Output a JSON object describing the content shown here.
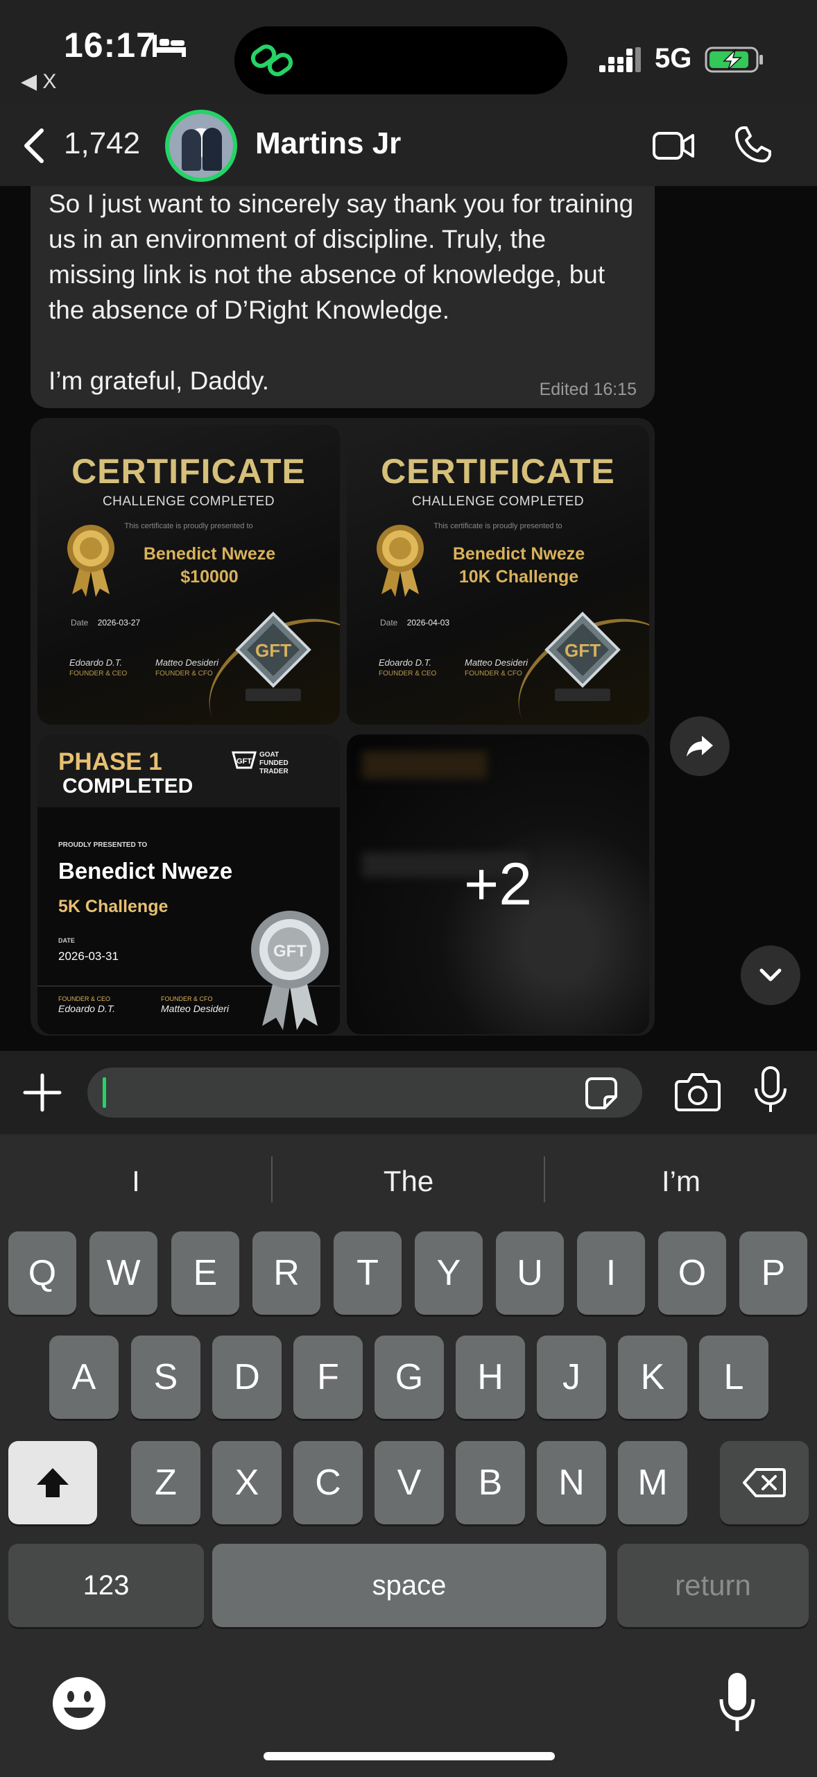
{
  "status_bar": {
    "time": "16:17",
    "back_app": "◀ X",
    "network": "5G"
  },
  "header": {
    "back_count": "1,742",
    "contact_name": "Martins Jr"
  },
  "message": {
    "text": "So I just want to sincerely say thank you for training us in an environment of discipline. Truly, the missing link is not the absence of knowledge, but the absence of D’Right Knowledge.\n\nI’m grateful, Daddy.",
    "edited": "Edited 16:15"
  },
  "album": {
    "cert1": {
      "title": "CERTIFICATE",
      "subtitle": "CHALLENGE COMPLETED",
      "presented": "This certificate is proudly presented to",
      "name": "Benedict Nweze",
      "detail": "$10000",
      "date_label": "Date",
      "date": "2026-03-27",
      "sig1_name": "Edoardo D.T.",
      "sig1_role": "FOUNDER & CEO",
      "sig2_name": "Matteo Desideri",
      "sig2_role": "FOUNDER & CFO"
    },
    "cert2": {
      "title": "CERTIFICATE",
      "subtitle": "CHALLENGE COMPLETED",
      "presented": "This certificate is proudly presented to",
      "name": "Benedict Nweze",
      "detail": "10K Challenge",
      "date_label": "Date",
      "date": "2026-04-03",
      "sig1_name": "Edoardo D.T.",
      "sig1_role": "FOUNDER & CEO",
      "sig2_name": "Matteo Desideri",
      "sig2_role": "FOUNDER & CFO"
    },
    "phase": {
      "title": "PHASE 1",
      "completed": "COMPLETED",
      "brand_l1": "GOAT",
      "brand_l2": "FUNDED",
      "brand_l3": "TRADER",
      "presented": "PROUDLY PRESENTED TO",
      "name": "Benedict Nweze",
      "challenge": "5K Challenge",
      "date_label": "DATE",
      "date": "2026-03-31",
      "sig1_role": "FOUNDER & CEO",
      "sig1_name": "Edoardo D.T.",
      "sig2_role": "FOUNDER & CFO",
      "sig2_name": "Matteo Desideri"
    },
    "more_count": "+2"
  },
  "keyboard": {
    "suggestions": [
      "I",
      "The",
      "I’m"
    ],
    "row1": [
      "Q",
      "W",
      "E",
      "R",
      "T",
      "Y",
      "U",
      "I",
      "O",
      "P"
    ],
    "row2": [
      "A",
      "S",
      "D",
      "F",
      "G",
      "H",
      "J",
      "K",
      "L"
    ],
    "row3": [
      "Z",
      "X",
      "C",
      "V",
      "B",
      "N",
      "M"
    ],
    "numbers": "123",
    "space": "space",
    "return": "return"
  },
  "colors": {
    "accent": "#25d366",
    "gold": "#d9b25c",
    "bubble": "#2a2a2a"
  }
}
